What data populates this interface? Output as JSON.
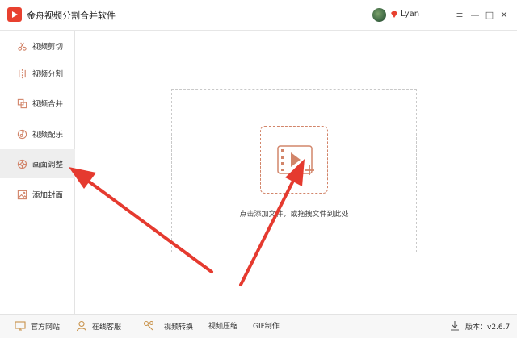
{
  "app": {
    "title": "金舟视频分割合并软件",
    "logo_icon": "play-logo-icon"
  },
  "user": {
    "name": "Lyan",
    "vip_icon": "vip-crown-icon"
  },
  "window_controls": {
    "menu": "≡",
    "minimize": "—",
    "maximize": "□",
    "close": "✕"
  },
  "sidebar": {
    "items": [
      {
        "label": "视频剪切",
        "icon": "scissors-icon"
      },
      {
        "label": "视频分割",
        "icon": "split-icon"
      },
      {
        "label": "视频合并",
        "icon": "merge-icon"
      },
      {
        "label": "视频配乐",
        "icon": "music-icon"
      },
      {
        "label": "画面调整",
        "icon": "adjust-icon",
        "active": true
      },
      {
        "label": "添加封面",
        "icon": "cover-image-icon"
      }
    ]
  },
  "main": {
    "drop_hint": "点击添加文件，或拖拽文件到此处"
  },
  "footer": {
    "items": [
      {
        "label": "官方网站",
        "icon": "monitor-icon"
      },
      {
        "label": "在线客服",
        "icon": "user-icon"
      },
      {
        "label": "视频转换",
        "icon": "tools-icon"
      },
      {
        "label": "视频压缩"
      },
      {
        "label": "GIF制作"
      }
    ],
    "version_label": "版本：v2.6.7",
    "version_icon": "download-icon"
  },
  "colors": {
    "accent": "#e8402f",
    "upload": "#d2856a",
    "arrow": "#e53a2f"
  }
}
